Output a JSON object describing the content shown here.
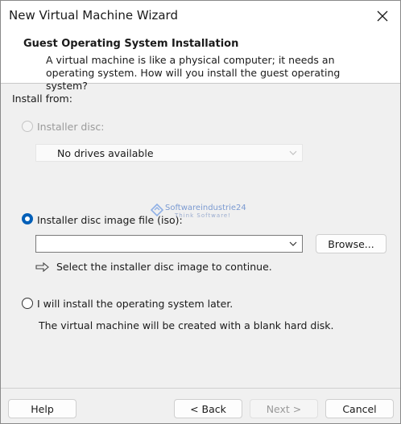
{
  "window": {
    "title": "New Virtual Machine Wizard"
  },
  "header": {
    "title": "Guest Operating System Installation",
    "description": "A virtual machine is like a physical computer; it needs an operating system. How will you install the guest operating system?"
  },
  "install_from_label": "Install from:",
  "options": {
    "installer_disc": {
      "label": "Installer disc:",
      "selected": false,
      "enabled": false,
      "drive_value": "No drives available"
    },
    "image_file": {
      "label": "Installer disc image file (iso):",
      "selected": true,
      "path_value": "",
      "browse_label": "Browse...",
      "hint": "Select the installer disc image to continue."
    },
    "install_later": {
      "label": "I will install the operating system later.",
      "selected": false,
      "note": "The virtual machine will be created with a blank hard disk."
    }
  },
  "watermark": {
    "name": "Softwareindustrie24",
    "tagline": "Think Software!"
  },
  "footer": {
    "help": "Help",
    "back": "< Back",
    "next": "Next >",
    "cancel": "Cancel"
  },
  "colors": {
    "accent": "#005fb8",
    "background": "#f0f0f0"
  }
}
